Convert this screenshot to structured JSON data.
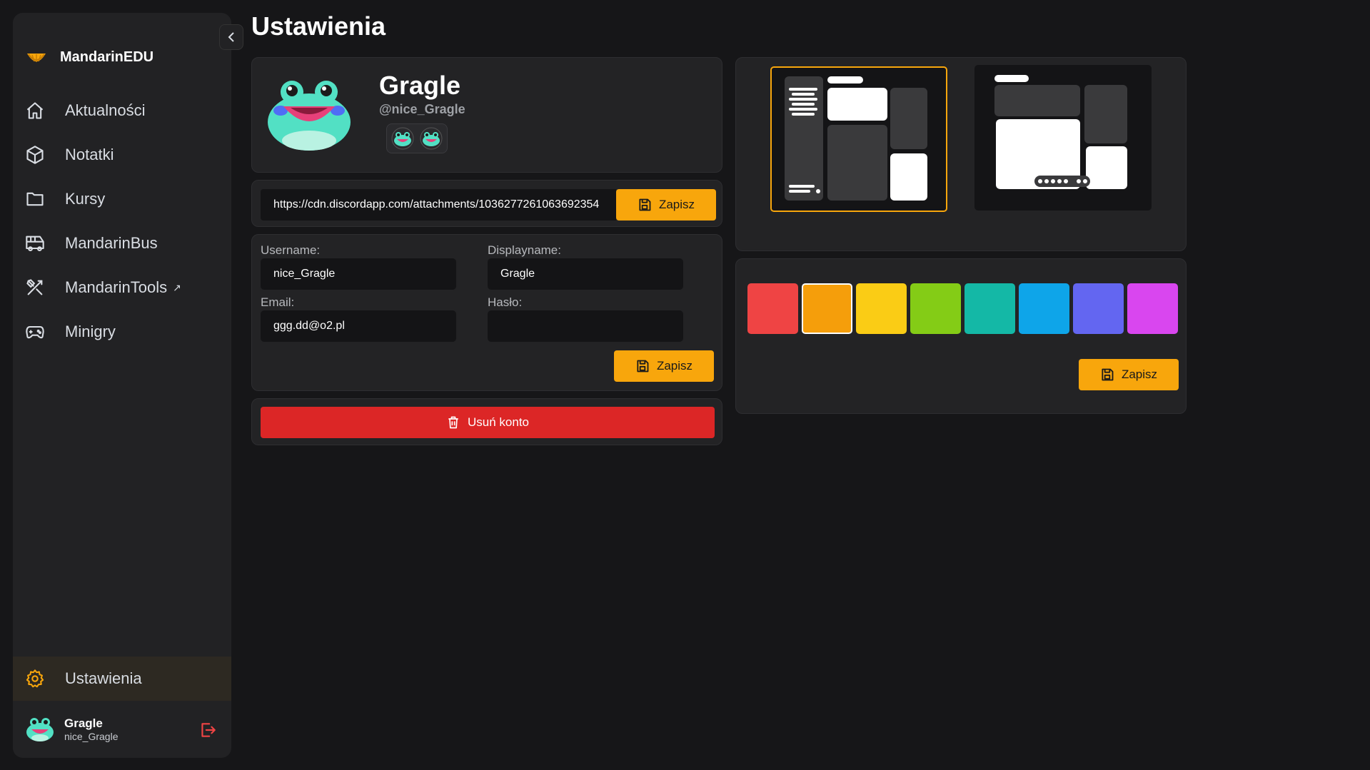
{
  "app": {
    "name": "MandarinEDU"
  },
  "sidebar": {
    "items": [
      {
        "label": "Aktualności",
        "icon": "home-icon"
      },
      {
        "label": "Notatki",
        "icon": "cube-icon"
      },
      {
        "label": "Kursy",
        "icon": "folder-icon"
      },
      {
        "label": "MandarinBus",
        "icon": "bus-icon"
      },
      {
        "label": "MandarinTools",
        "icon": "tools-icon"
      },
      {
        "label": "Minigry",
        "icon": "gamepad-icon"
      }
    ],
    "active_item": {
      "label": "Ustawienia",
      "icon": "gear-icon"
    },
    "user": {
      "displayname": "Gragle",
      "username": "nice_Gragle"
    }
  },
  "page": {
    "title": "Ustawienia"
  },
  "profile": {
    "displayname": "Gragle",
    "handle": "@nice_Gragle"
  },
  "avatar_url": {
    "value": "https://cdn.discordapp.com/attachments/1036277261063692354",
    "save_label": "Zapisz"
  },
  "account": {
    "username_label": "Username:",
    "username_value": "nice_Gragle",
    "displayname_label": "Displayname:",
    "displayname_value": "Gragle",
    "email_label": "Email:",
    "email_value": "ggg.dd@o2.pl",
    "password_label": "Hasło:",
    "password_value": "",
    "save_label": "Zapisz"
  },
  "danger": {
    "delete_label": "Usuń konto"
  },
  "layout": {
    "selected_index": 0
  },
  "theme": {
    "colors": [
      "#ef4444",
      "#f59e0b",
      "#facc15",
      "#84cc16",
      "#14b8a6",
      "#0ea5e9",
      "#6366f1",
      "#d946ef"
    ],
    "selected_index": 1,
    "save_label": "Zapisz"
  },
  "accent_color": "#f8a60c",
  "danger_color": "#dc2626"
}
